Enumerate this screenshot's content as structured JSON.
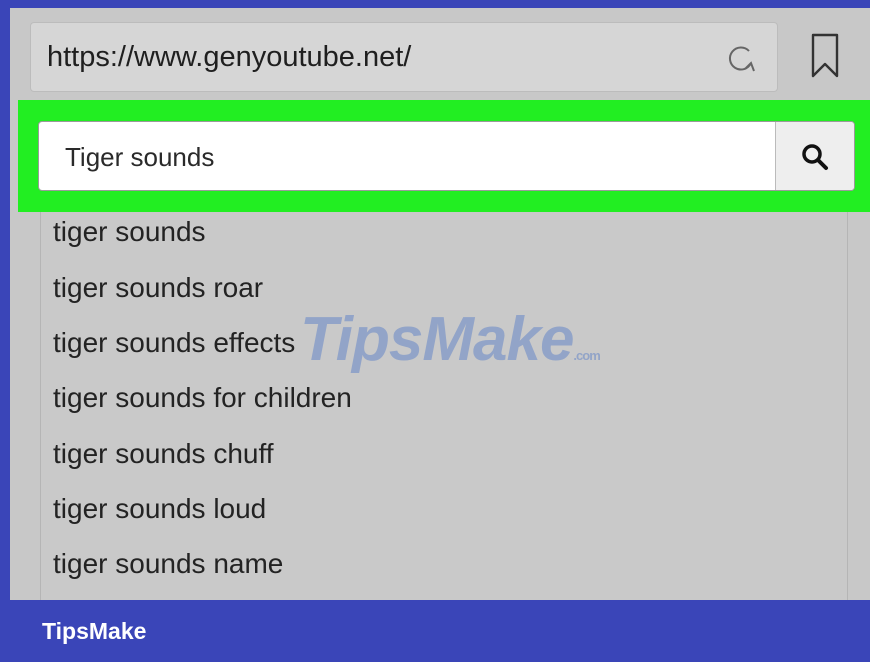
{
  "browser": {
    "url": "https://www.genyoutube.net/",
    "reload_icon": "reload-icon",
    "bookmark_icon": "bookmark-icon"
  },
  "search": {
    "value": "Tiger sounds",
    "icon": "search-icon",
    "highlight_color": "#22ee22"
  },
  "suggestions": [
    "tiger sounds",
    "tiger sounds roar",
    "tiger sounds effects",
    "tiger sounds for children",
    "tiger sounds chuff",
    "tiger sounds loud",
    "tiger sounds name"
  ],
  "watermark": {
    "text": "TipsMake",
    "suffix": ".com"
  },
  "footer": {
    "brand": "TipsMake",
    "background": "#3a45b8"
  }
}
